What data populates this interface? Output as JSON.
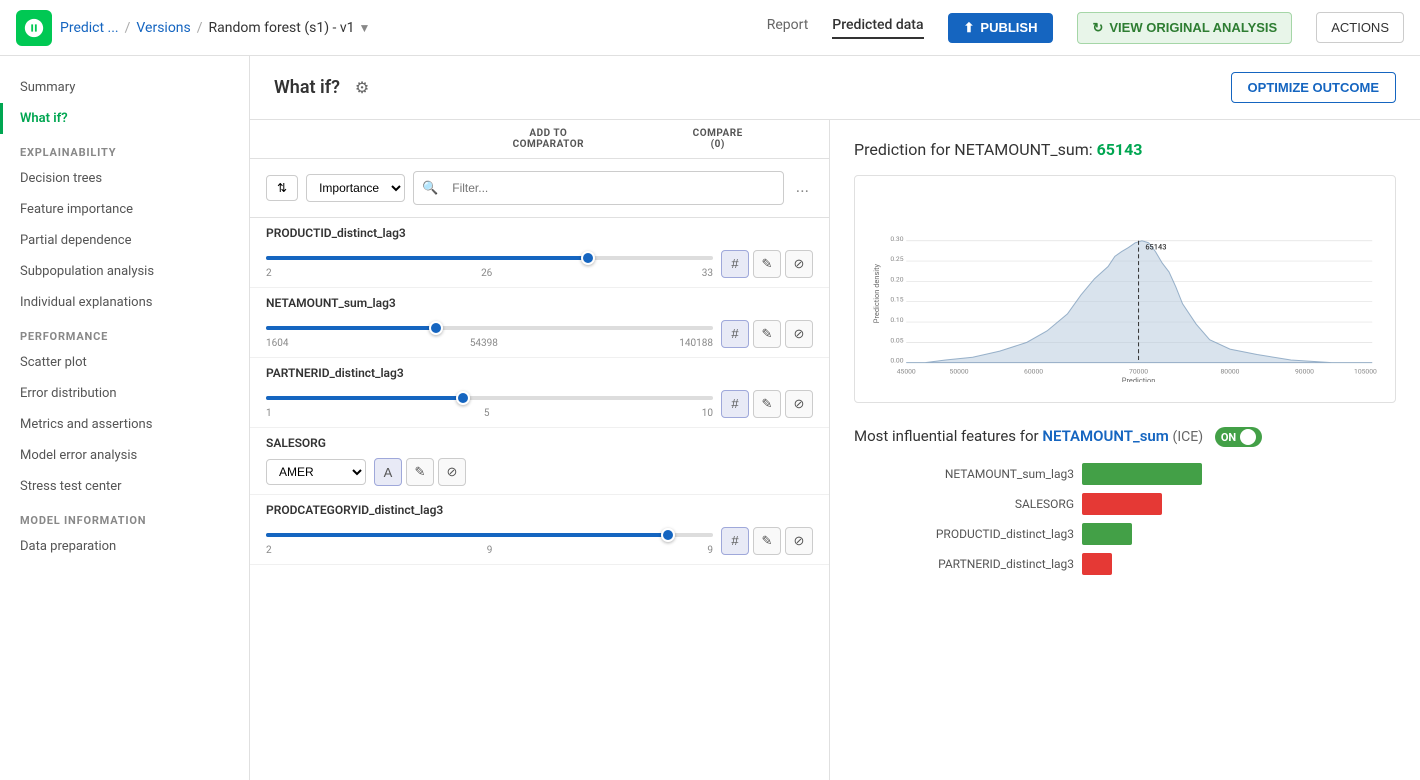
{
  "topbar": {
    "logo_alt": "DataRobot",
    "breadcrumb": [
      "Predict ...",
      "Versions",
      "Random forest (s1) - v1"
    ],
    "nav_tabs": [
      "Report",
      "Predicted data"
    ],
    "active_tab": "Report",
    "publish_label": "PUBLISH",
    "view_original_label": "VIEW ORIGINAL ANALYSIS",
    "actions_label": "ACTIONS"
  },
  "sidebar": {
    "summary_label": "Summary",
    "whatif_label": "What if?",
    "sections": [
      {
        "id": "explainability",
        "title": "EXPLAINABILITY",
        "items": [
          {
            "id": "decision-trees",
            "label": "Decision trees"
          },
          {
            "id": "feature-importance",
            "label": "Feature importance"
          },
          {
            "id": "partial-dependence",
            "label": "Partial dependence"
          },
          {
            "id": "subpopulation-analysis",
            "label": "Subpopulation analysis"
          },
          {
            "id": "individual-explanations",
            "label": "Individual explanations"
          }
        ]
      },
      {
        "id": "performance",
        "title": "PERFORMANCE",
        "items": [
          {
            "id": "scatter-plot",
            "label": "Scatter plot"
          },
          {
            "id": "error-distribution",
            "label": "Error distribution"
          },
          {
            "id": "metrics-assertions",
            "label": "Metrics and assertions"
          },
          {
            "id": "model-error-analysis",
            "label": "Model error analysis"
          },
          {
            "id": "stress-test-center",
            "label": "Stress test center"
          }
        ]
      },
      {
        "id": "model-information",
        "title": "MODEL INFORMATION",
        "items": [
          {
            "id": "data-preparation",
            "label": "Data preparation"
          }
        ]
      }
    ]
  },
  "whatif": {
    "title": "What if?",
    "gear_icon": "⚙",
    "optimize_label": "OPTIMIZE OUTCOME",
    "toolbar": {
      "sort_label": "Sort",
      "importance_label": "Importance",
      "filter_placeholder": "Filter..."
    },
    "col_headers": {
      "add_to_comparator": "ADD TO\nCOMPARATOR",
      "compare": "COMPARE\n(0)"
    },
    "ellipsis": "...",
    "features": [
      {
        "name": "PRODUCTID_distinct_lag3",
        "slider_min": "2",
        "slider_max": "33",
        "slider_val": "26",
        "slider_pct": 72,
        "type": "slider",
        "buttons": [
          "#",
          "edit",
          "reset"
        ]
      },
      {
        "name": "NETAMOUNT_sum_lag3",
        "slider_min": "1604",
        "slider_max": "140188",
        "slider_val": "54398",
        "slider_pct": 38,
        "type": "slider",
        "buttons": [
          "#",
          "edit",
          "reset"
        ]
      },
      {
        "name": "PARTNERID_distinct_lag3",
        "slider_min": "1",
        "slider_max": "10",
        "slider_val": "5",
        "slider_pct": 44,
        "type": "slider",
        "buttons": [
          "#",
          "edit",
          "reset"
        ]
      },
      {
        "name": "SALESORG",
        "type": "dropdown",
        "dropdown_value": "AMER",
        "buttons": [
          "A",
          "edit",
          "reset"
        ]
      },
      {
        "name": "PRODCATEGORYID_distinct_lag3",
        "slider_min": "2",
        "slider_max": "9",
        "slider_val": "9",
        "slider_pct": 90,
        "type": "slider",
        "buttons": [
          "#",
          "edit",
          "reset"
        ]
      }
    ]
  },
  "chart": {
    "title_prefix": "Prediction for NETAMOUNT_sum:",
    "prediction_value": "65143",
    "x_axis_label": "Prediction",
    "y_axis_label": "Prediction density",
    "x_ticks": [
      "45000",
      "50000",
      "60000",
      "70000",
      "80000",
      "90000",
      "105000"
    ],
    "y_ticks": [
      "0.00",
      "0.05",
      "0.10",
      "0.15",
      "0.20",
      "0.25",
      "0.30"
    ],
    "vertical_line_label": "65143"
  },
  "influential": {
    "title_prefix": "Most influential features for",
    "feature_link": "NETAMOUNT_sum",
    "ice_label": "(ICE)",
    "toggle_label": "ON",
    "bars": [
      {
        "label": "NETAMOUNT_sum_lag3",
        "value": 120,
        "direction": "green"
      },
      {
        "label": "SALESORG",
        "value": 80,
        "direction": "red"
      },
      {
        "label": "PRODUCTID_distinct_lag3",
        "value": 50,
        "direction": "green"
      },
      {
        "label": "PARTNERID_distinct_lag3",
        "value": 30,
        "direction": "red"
      }
    ]
  }
}
